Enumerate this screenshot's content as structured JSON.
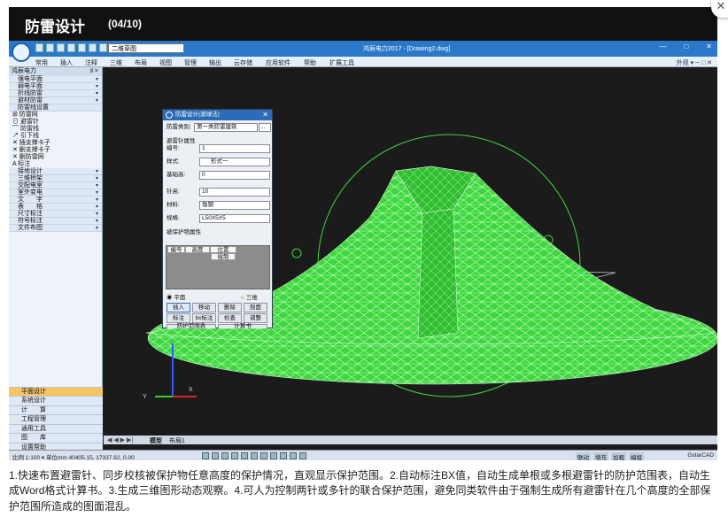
{
  "header": {
    "title": "防雷设计",
    "counter": "(04/10)"
  },
  "app": {
    "workspace": "二维草图",
    "window_title": "鸿辰电力2017 - [Drawing2.dwg]",
    "win_buttons": [
      "—",
      "□",
      "✕"
    ],
    "ribbon_tabs": [
      "常用",
      "插入",
      "注释",
      "三维",
      "布局",
      "视图",
      "管理",
      "输出",
      "云存储",
      "应用软件",
      "帮助",
      "扩展工具"
    ],
    "ribbon_right": "外观 ▾  ─ □ ✕"
  },
  "left_panel": {
    "title": "鸿辰电力",
    "pin": "♯ ×",
    "items": [
      {
        "label": "强电平面",
        "style": "cat"
      },
      {
        "label": "弱电平面",
        "style": "cat"
      },
      {
        "label": "折线防雷",
        "style": "cat"
      },
      {
        "label": "避材防雷",
        "style": "cat"
      },
      {
        "label": "防雷线设置",
        "style": "blue"
      },
      {
        "label": "⊞ 防雷网",
        "style": "plain"
      },
      {
        "label": "⊙ 避雷针",
        "style": "plain"
      },
      {
        "label": "⌒ 防雷线",
        "style": "plain"
      },
      {
        "label": "↗ 引下线",
        "style": "plain"
      },
      {
        "label": "✕ 插支撑卡子",
        "style": "plain"
      },
      {
        "label": "✕ 删支撑卡子",
        "style": "plain"
      },
      {
        "label": "✕ 删防雷网",
        "style": "plain"
      },
      {
        "label": "A 标注",
        "style": "plain"
      },
      {
        "label": "接地设计",
        "style": "cat"
      },
      {
        "label": "三维桥架",
        "style": "cat"
      },
      {
        "label": "交配电室",
        "style": "cat"
      },
      {
        "label": "室外变电",
        "style": "cat"
      },
      {
        "label": "文　　字",
        "style": "cat"
      },
      {
        "label": "表　　格",
        "style": "cat"
      },
      {
        "label": "尺寸标注",
        "style": "cat"
      },
      {
        "label": "符号标注",
        "style": "cat"
      },
      {
        "label": "文件布图",
        "style": "cat"
      }
    ],
    "bottom_items": [
      "平面设计",
      "系统设计",
      "计　　算",
      "工程管理",
      "通用工具",
      "图　　库",
      "设置帮助"
    ]
  },
  "dialog": {
    "title": "防雷设计(滚球法)",
    "close": "✕",
    "type_label": "防雷类别:",
    "type_value": "第一类防雷建筑",
    "more": "...",
    "section1": "避雷针属性",
    "fields": [
      {
        "label": "编号:",
        "value": "1"
      },
      {
        "label": "样式:",
        "value": "形式一"
      },
      {
        "label": "基础高:",
        "value": "0"
      },
      {
        "label": "针高:",
        "value": "10"
      },
      {
        "label": "材料:",
        "value": "角钢"
      },
      {
        "label": "规格:",
        "value": "L50X5X5"
      }
    ],
    "section2": "被保护物属性",
    "grid_headers": [
      "编号",
      "高度",
      "位置"
    ],
    "grid_button": "绘制",
    "radio1": "平面",
    "radio2": "三维",
    "buttons": [
      "插入",
      "移动",
      "删除",
      "剖面",
      "标注",
      "bx标注",
      "检查",
      "调整",
      "防护范围表",
      "计算书"
    ]
  },
  "canvas": {
    "tab_arrows": "◀ ◀ ▶ ▶|",
    "tabs": [
      "模型",
      "布局1"
    ]
  },
  "status": {
    "coords": "比例 1:100 ▾  单位mm  40405.15, 17337.92, 0.00",
    "right_buttons": [
      "联动",
      "填充",
      "加粗",
      "编组"
    ],
    "brand": "GstarCAD"
  },
  "caption": "1.快速布置避雷针、同步校核被保护物任意高度的保护情况，直观显示保护范围。2.自动标注BX值，自动生成单根或多根避雷针的防护范围表，自动生成Word格式计算书。3.生成三维图形动态观察。4.可人为控制两针或多针的联合保护范围，避免同类软件由于强制生成所有避雷针在几个高度的全部保护范围所造成的图面混乱。"
}
